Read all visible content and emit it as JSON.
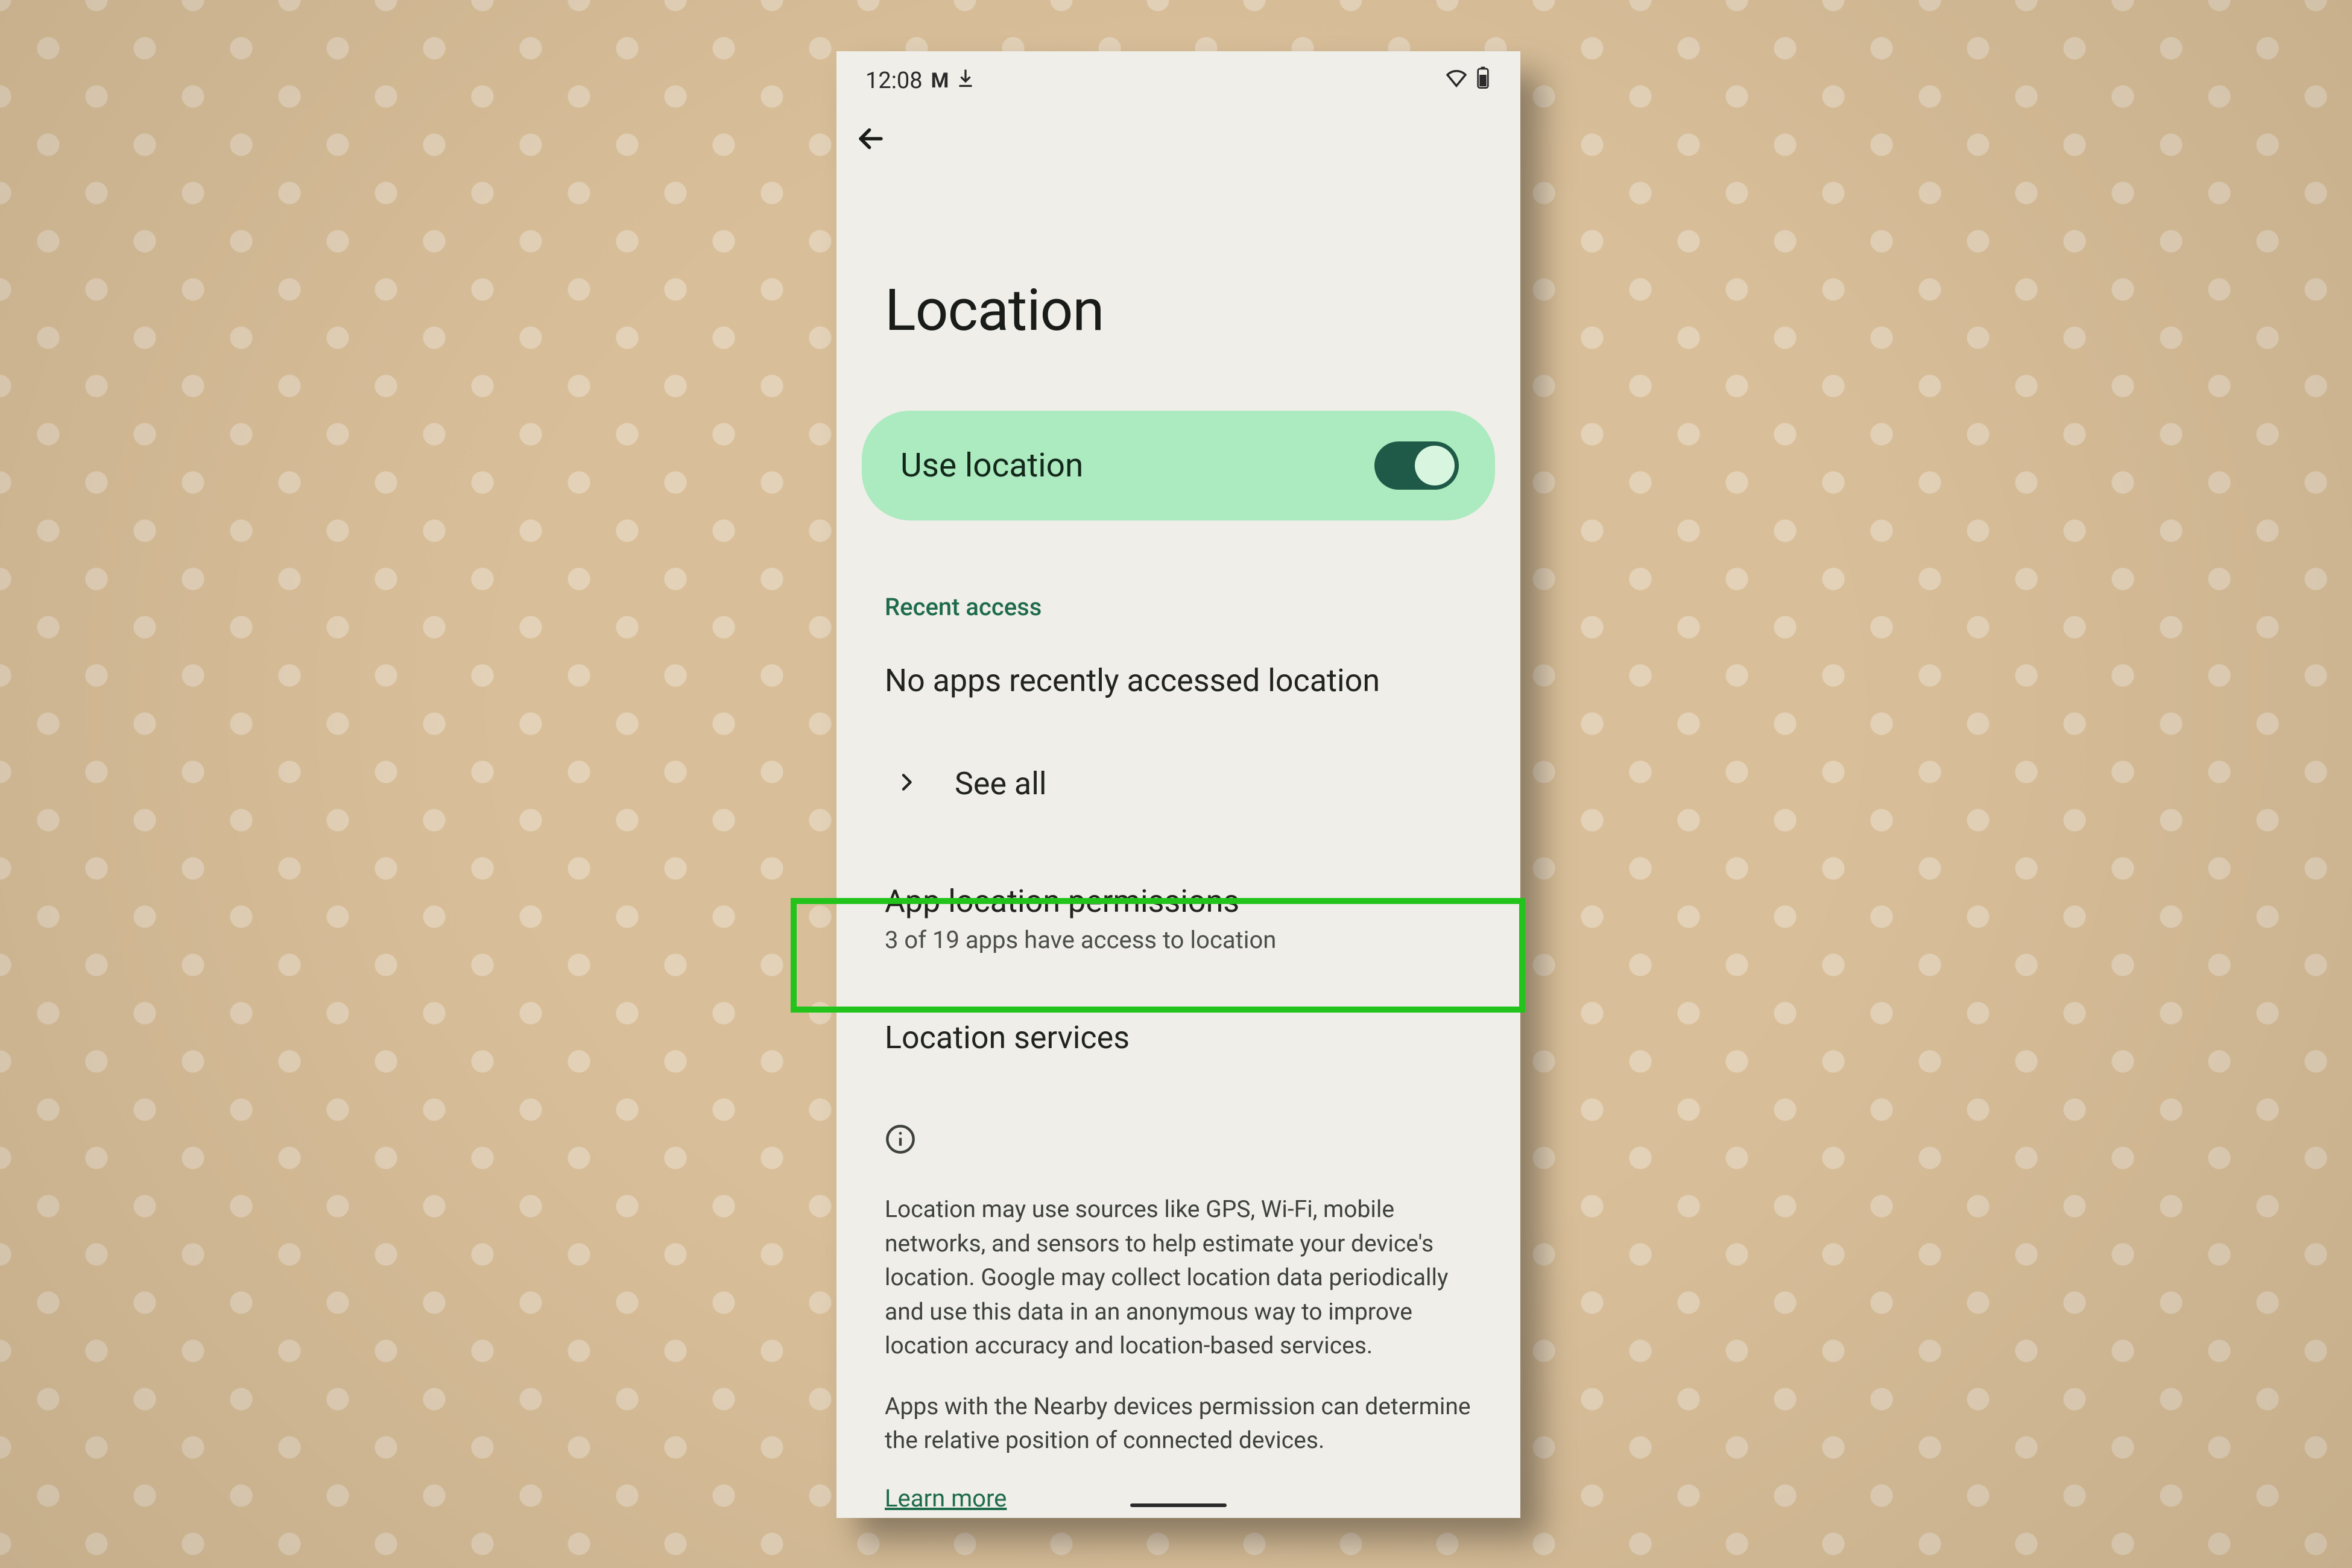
{
  "status": {
    "time": "12:08",
    "mail_icon": "gmail-icon",
    "download_icon": "download-icon",
    "wifi_icon": "wifi-icon",
    "battery_icon": "battery-icon"
  },
  "nav": {
    "back": "back"
  },
  "page": {
    "title": "Location"
  },
  "toggle": {
    "label": "Use location",
    "state": "on"
  },
  "recent": {
    "section_label": "Recent access",
    "empty_text": "No apps recently accessed location",
    "see_all": "See all"
  },
  "permissions": {
    "title": "App location permissions",
    "subtitle": "3 of 19 apps have access to location"
  },
  "services": {
    "title": "Location services"
  },
  "info": {
    "para1": "Location may use sources like GPS, Wi-Fi, mobile networks, and sensors to help estimate your device's location. Google may collect location data periodically and use this data in an anonymous way to improve location accuracy and location-based services.",
    "para2": "Apps with the Nearby devices permission can determine the relative position of connected devices.",
    "learn_more": "Learn more"
  },
  "highlight": {
    "target": "app-location-permissions"
  }
}
